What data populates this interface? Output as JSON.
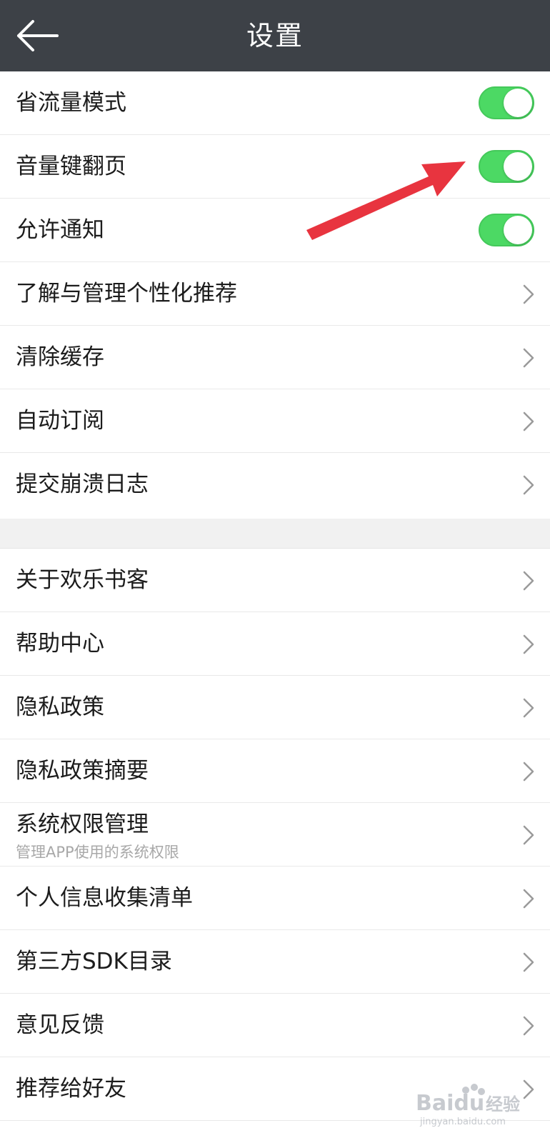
{
  "header": {
    "title": "设置",
    "back_icon": "arrow-left-icon",
    "background": "#3d4147"
  },
  "settings_group_1": [
    {
      "label": "省流量模式",
      "control": "toggle",
      "on": true
    },
    {
      "label": "音量键翻页",
      "control": "toggle",
      "on": true
    },
    {
      "label": "允许通知",
      "control": "toggle",
      "on": true
    },
    {
      "label": "了解与管理个性化推荐",
      "control": "chevron"
    },
    {
      "label": "清除缓存",
      "control": "chevron"
    },
    {
      "label": "自动订阅",
      "control": "chevron"
    },
    {
      "label": "提交崩溃日志",
      "control": "chevron"
    }
  ],
  "settings_group_2": [
    {
      "label": "关于欢乐书客",
      "control": "chevron"
    },
    {
      "label": "帮助中心",
      "control": "chevron"
    },
    {
      "label": "隐私政策",
      "control": "chevron"
    },
    {
      "label": "隐私政策摘要",
      "control": "chevron"
    },
    {
      "label": "系统权限管理",
      "sublabel": "管理APP使用的系统权限",
      "control": "chevron"
    },
    {
      "label": "个人信息收集清单",
      "control": "chevron"
    },
    {
      "label": "第三方SDK目录",
      "control": "chevron"
    },
    {
      "label": "意见反馈",
      "control": "chevron"
    },
    {
      "label": "推荐给好友",
      "control": "chevron"
    }
  ],
  "colors": {
    "toggle_on": "#4cd964",
    "annotation_arrow": "#e8343f"
  },
  "watermark": {
    "brand": "Baidu",
    "text": "经验",
    "url": "jingyan.baidu.com"
  }
}
